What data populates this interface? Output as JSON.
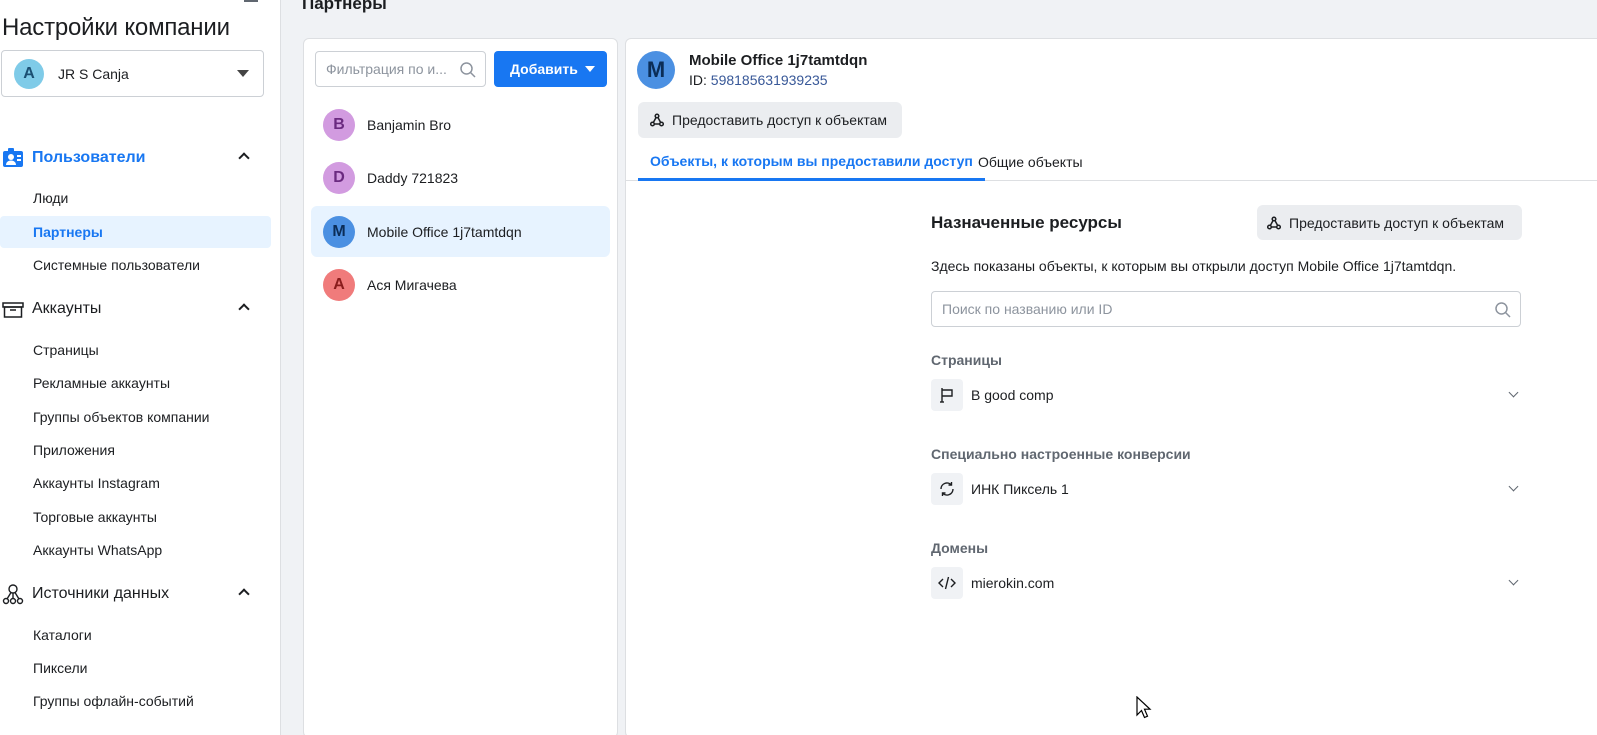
{
  "sidebar": {
    "title": "Настройки компании",
    "company": {
      "avatar_letter": "A",
      "name": "JR S Canja"
    },
    "sections": [
      {
        "label": "Пользователи",
        "icon": "users-icon",
        "active": true,
        "items": [
          "Люди",
          "Партнеры",
          "Системные пользователи"
        ]
      },
      {
        "label": "Аккаунты",
        "icon": "accounts-box-icon",
        "active": false,
        "items": [
          "Страницы",
          "Рекламные аккаунты",
          "Группы объектов компании",
          "Приложения",
          "Аккаунты Instagram",
          "Торговые аккаунты",
          "Аккаунты WhatsApp"
        ]
      },
      {
        "label": "Источники данных",
        "icon": "data-sources-icon",
        "active": false,
        "items": [
          "Каталоги",
          "Пиксели",
          "Группы офлайн-событий"
        ]
      }
    ],
    "selected_item": "Партнеры"
  },
  "page": {
    "title": "Партнеры"
  },
  "partners_panel": {
    "filter_placeholder": "Фильтрация по и...",
    "add_label": "Добавить",
    "partners": [
      {
        "letter": "B",
        "name": "Banjamin Bro",
        "avatar_bg": "#d29be0",
        "avatar_fg": "#6b2a80"
      },
      {
        "letter": "D",
        "name": "Daddy 721823",
        "avatar_bg": "#d29be0",
        "avatar_fg": "#6b2a80"
      },
      {
        "letter": "M",
        "name": "Mobile Office 1j7tamtdqn",
        "avatar_bg": "#4b90e2",
        "avatar_fg": "#0b2d57",
        "selected": true
      },
      {
        "letter": "А",
        "name": "Ася Мигачева",
        "avatar_bg": "#f07b7b",
        "avatar_fg": "#8a1c1c"
      }
    ]
  },
  "detail": {
    "avatar_letter": "M",
    "name": "Mobile Office 1j7tamtdqn",
    "id_label": "ID:",
    "id_value": "598185631939235",
    "grant_label": "Предоставить доступ к объектам",
    "tabs": [
      {
        "label": "Объекты, к которым вы предоставили доступ",
        "active": true
      },
      {
        "label": "Общие объекты",
        "active": false
      }
    ],
    "resources": {
      "title": "Назначенные ресурсы",
      "grant_label": "Предоставить доступ к объектам",
      "description": "Здесь показаны объекты, к которым вы открыли доступ Mobile Office 1j7tamtdqn.",
      "search_placeholder": "Поиск по названию или ID",
      "categories": [
        {
          "label": "Страницы",
          "item": "B good comp",
          "icon": "flag-icon"
        },
        {
          "label": "Специально настроенные конверсии",
          "item": "ИНК Пиксель 1",
          "icon": "refresh-icon"
        },
        {
          "label": "Домены",
          "item": "mierokin.com",
          "icon": "code-icon"
        }
      ]
    }
  },
  "colors": {
    "accent": "#1877f2",
    "selected_bg": "#e7f3ff",
    "button_gray": "#ebedf0"
  }
}
